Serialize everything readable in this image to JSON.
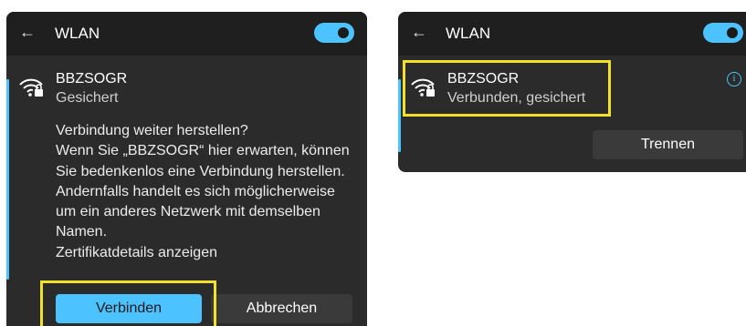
{
  "left_panel": {
    "back_icon": "←",
    "title": "WLAN",
    "toggle_on": true,
    "network": {
      "name": "BBZSOGR",
      "status": "Gesichert",
      "icon": "wifi-secured-icon"
    },
    "prompt_lines": [
      "Verbindung weiter herstellen?",
      "Wenn Sie „BBZSOGR“ hier erwarten, können",
      "Sie bedenkenlos eine Verbindung herstellen.",
      "Andernfalls handelt es sich möglicherweise",
      "um ein anderes Netzwerk mit demselben",
      "Namen.",
      "Zertifikatdetails anzeigen"
    ],
    "connect_label": "Verbinden",
    "cancel_label": "Abbrechen"
  },
  "right_panel": {
    "back_icon": "←",
    "title": "WLAN",
    "toggle_on": true,
    "network": {
      "name": "BBZSOGR",
      "status": "Verbunden, gesichert",
      "icon": "wifi-secured-icon"
    },
    "info_icon": "i",
    "disconnect_label": "Trennen"
  },
  "colors": {
    "accent": "#4cc2ff",
    "panel": "#2b2b2b",
    "header": "#1f1f1f",
    "highlight": "#f1e12b"
  }
}
